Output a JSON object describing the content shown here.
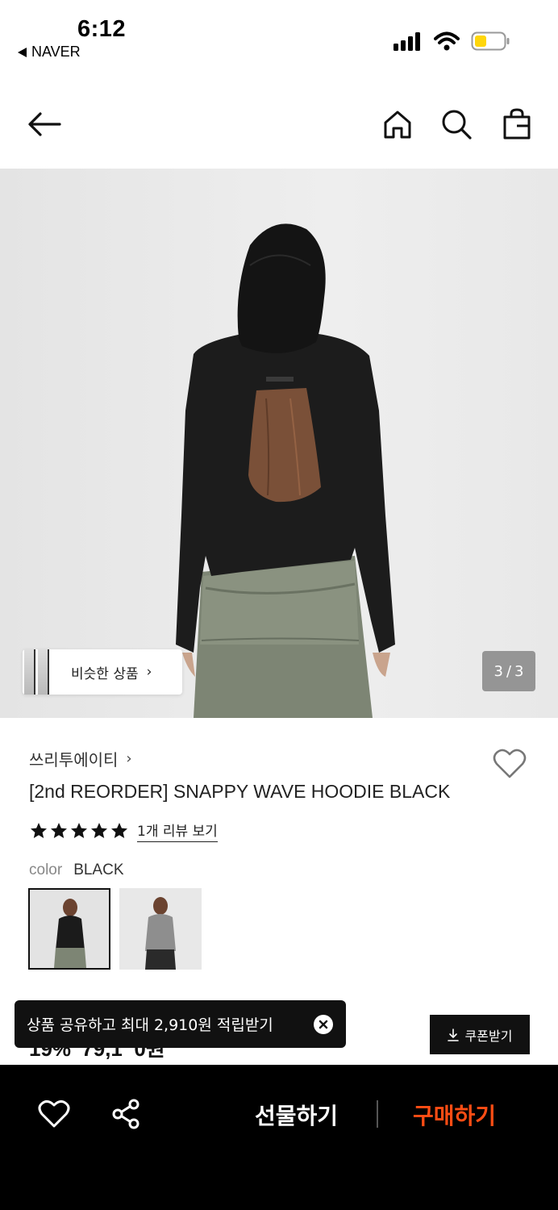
{
  "status_bar": {
    "time": "6:12",
    "back_app": "NAVER"
  },
  "nav": {
    "icons": [
      "back-arrow-icon",
      "home-icon",
      "search-icon",
      "shopping-bag-icon"
    ]
  },
  "gallery": {
    "similar_label": "비슷한 상품",
    "page_current": "3",
    "page_sep": "/",
    "page_total": "3"
  },
  "product": {
    "brand": "쓰리투에이티",
    "title": "[2nd REORDER] SNAPPY WAVE HOODIE BLACK",
    "rating_stars": 5,
    "review_link": "1개 리뷰 보기",
    "color_label": "color",
    "color_value": "BLACK",
    "colors": [
      "black",
      "grey"
    ],
    "price_partial": "19%",
    "price_amount_partial": "79,1  0원"
  },
  "coupon": {
    "label": "쿠폰받기"
  },
  "toast": {
    "text": "상품 공유하고 최대 2,910원 적립받기"
  },
  "bottom_bar": {
    "gift": "선물하기",
    "buy": "구매하기"
  },
  "colors": {
    "buy_accent": "#ff4d14",
    "bar_bg": "#000000"
  }
}
